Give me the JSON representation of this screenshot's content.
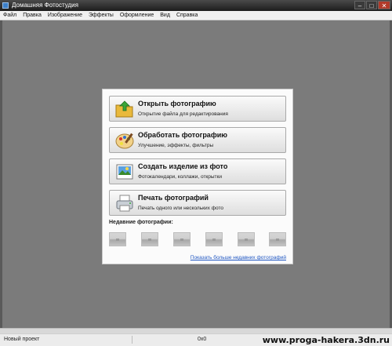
{
  "window": {
    "title": "Домашняя Фотостудия",
    "controls": [
      "–",
      "□",
      "✕"
    ]
  },
  "menu": [
    "Файл",
    "Правка",
    "Изображение",
    "Эффекты",
    "Оформление",
    "Вид",
    "Справка"
  ],
  "actions": [
    {
      "label": "Открыть фотографию",
      "desc": "Открытие файла для редактирования",
      "icon": "folder-open-icon"
    },
    {
      "label": "Обработать фотографию",
      "desc": "Улучшение, эффекты, фильтры",
      "icon": "palette-icon"
    },
    {
      "label": "Создать изделие из фото",
      "desc": "Фотокалендари, коллажи, открытки",
      "icon": "photo-frame-icon"
    },
    {
      "label": "Печать фотографий",
      "desc": "Печать одного или нескольких фото",
      "icon": "printer-icon"
    }
  ],
  "recent": {
    "title": "Недавние фотографии:",
    "count": 6,
    "more_link": "Показать больше недавних фотографий"
  },
  "status": {
    "left": "Новый проект",
    "mid": "0x0"
  },
  "watermark": "www.proga-hakera.3dn.ru"
}
